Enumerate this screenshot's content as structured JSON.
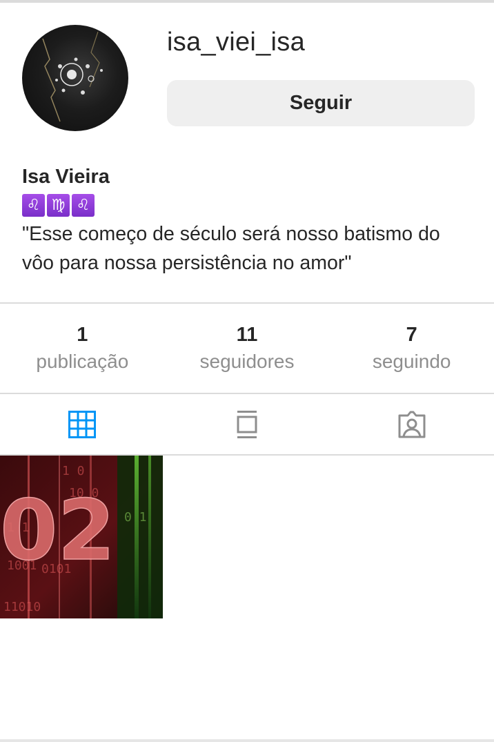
{
  "profile": {
    "username": "isa_viei_isa",
    "follow_label": "Seguir",
    "full_name": "Isa Vieira",
    "zodiac_signs": [
      "♌",
      "♍",
      "♌"
    ],
    "bio_line1": "\"Esse começo de século será nosso batismo do",
    "bio_line2": "vôo para nossa persistência no amor\""
  },
  "stats": {
    "posts_count": "1",
    "posts_label": "publicação",
    "followers_count": "11",
    "followers_label": "seguidores",
    "following_count": "7",
    "following_label": "seguindo"
  },
  "tabs": {
    "icons": [
      "grid-icon",
      "feed-icon",
      "tagged-icon"
    ],
    "active_color": "#0095f6",
    "inactive_color": "#8e8e8e"
  },
  "post": {
    "overlay_text": "02",
    "binary_rows": [
      "1 0",
      "10 0",
      "1 1",
      "0 1",
      "1001",
      "0101",
      "11010"
    ]
  }
}
